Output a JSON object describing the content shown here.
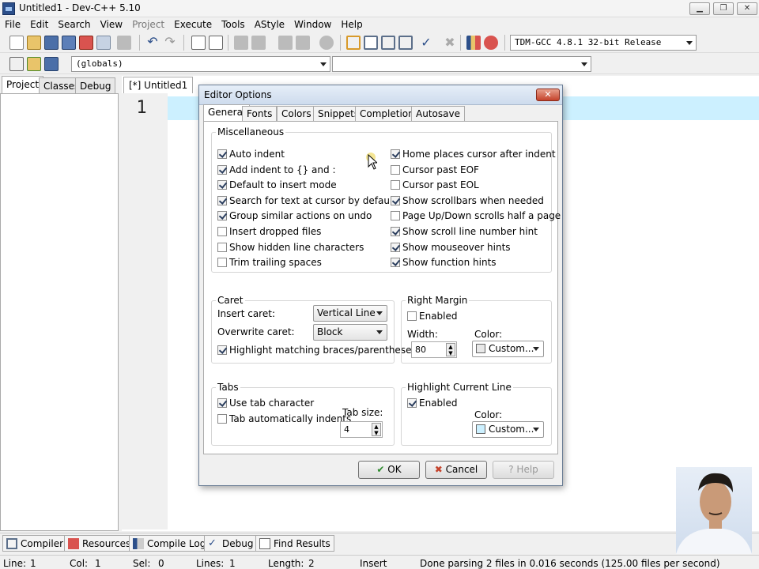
{
  "window": {
    "title": "Untitled1 - Dev-C++ 5.10",
    "controls": [
      "minimize",
      "restore",
      "close"
    ]
  },
  "menu": [
    {
      "label": "File",
      "enabled": true
    },
    {
      "label": "Edit",
      "enabled": true
    },
    {
      "label": "Search",
      "enabled": true
    },
    {
      "label": "View",
      "enabled": true
    },
    {
      "label": "Project",
      "enabled": false
    },
    {
      "label": "Execute",
      "enabled": true
    },
    {
      "label": "Tools",
      "enabled": true
    },
    {
      "label": "AStyle",
      "enabled": true
    },
    {
      "label": "Window",
      "enabled": true
    },
    {
      "label": "Help",
      "enabled": true
    }
  ],
  "toolbar": {
    "compiler": "TDM-GCC 4.8.1 32-bit Release",
    "scope": "(globals)",
    "function": ""
  },
  "left_tabs": [
    "Project",
    "Classes",
    "Debug"
  ],
  "editor": {
    "tab": "[*] Untitled1",
    "line_number": "1"
  },
  "dialog": {
    "title": "Editor Options",
    "close": "✕",
    "tabs": [
      "General",
      "Fonts",
      "Colors",
      "Snippets",
      "Completion",
      "Autosave"
    ],
    "misc": {
      "label": "Miscellaneous",
      "left": [
        {
          "label": "Auto indent",
          "checked": true
        },
        {
          "label": "Add indent to {} and :",
          "checked": true
        },
        {
          "label": "Default to insert mode",
          "checked": true
        },
        {
          "label": "Search for text at cursor by default",
          "checked": true
        },
        {
          "label": "Group similar actions on undo",
          "checked": true
        },
        {
          "label": "Insert dropped files",
          "checked": false
        },
        {
          "label": "Show hidden line characters",
          "checked": false
        },
        {
          "label": "Trim trailing spaces",
          "checked": false
        }
      ],
      "right": [
        {
          "label": "Home places cursor after indent",
          "checked": true
        },
        {
          "label": "Cursor past EOF",
          "checked": false
        },
        {
          "label": "Cursor past EOL",
          "checked": false
        },
        {
          "label": "Show scrollbars when needed",
          "checked": true
        },
        {
          "label": "Page Up/Down scrolls half a page",
          "checked": false
        },
        {
          "label": "Show scroll line number hint",
          "checked": true
        },
        {
          "label": "Show mouseover hints",
          "checked": true
        },
        {
          "label": "Show function hints",
          "checked": true
        }
      ]
    },
    "caret": {
      "label": "Caret",
      "insert_label": "Insert caret:",
      "insert_value": "Vertical Line",
      "overwrite_label": "Overwrite caret:",
      "overwrite_value": "Block",
      "highlight_label": "Highlight matching braces/parentheses",
      "highlight_checked": true
    },
    "right_margin": {
      "label": "Right Margin",
      "enabled_label": "Enabled",
      "enabled": false,
      "width_label": "Width:",
      "width": "80",
      "color_label": "Color:",
      "color_value": "Custom...",
      "color": "#e8e8e8"
    },
    "tabs_group": {
      "label": "Tabs",
      "use_tab_label": "Use tab character",
      "use_tab": true,
      "auto_indent_label": "Tab automatically indents",
      "auto_indent": false,
      "size_label": "Tab size:",
      "size": "4"
    },
    "highlight_line": {
      "label": "Highlight Current Line",
      "enabled_label": "Enabled",
      "enabled": true,
      "color_label": "Color:",
      "color_value": "Custom...",
      "color": "#ccf0ff"
    },
    "buttons": {
      "ok": "OK",
      "cancel": "Cancel",
      "help": "Help"
    }
  },
  "bottom_tabs": [
    "Compiler",
    "Resources",
    "Compile Log",
    "Debug",
    "Find Results"
  ],
  "status": {
    "line_label": "Line:",
    "line": "1",
    "col_label": "Col:",
    "col": "1",
    "sel_label": "Sel:",
    "sel": "0",
    "lines_label": "Lines:",
    "lines": "1",
    "length_label": "Length:",
    "length": "2",
    "mode": "Insert",
    "message": "Done parsing 2 files in 0.016 seconds (125.00 files per second)"
  }
}
